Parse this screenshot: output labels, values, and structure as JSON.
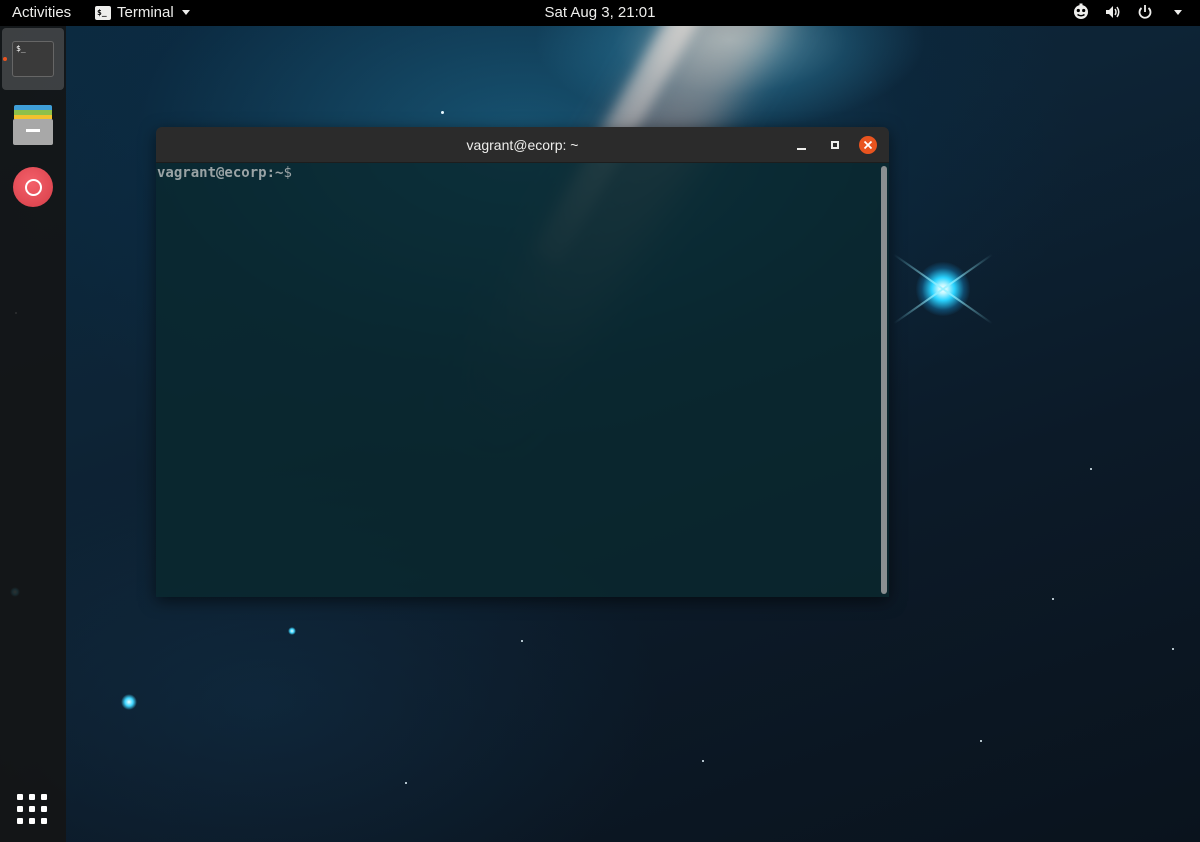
{
  "topbar": {
    "activities_label": "Activities",
    "app_menu_label": "Terminal",
    "app_menu_icon_text": "$_",
    "clock": "Sat Aug  3, 21:01",
    "tray_icons": [
      "accessibility-icon",
      "volume-icon",
      "power-icon",
      "system-menu-caret-icon"
    ]
  },
  "dock": {
    "items": [
      {
        "name": "Terminal",
        "icon": "terminal-icon",
        "icon_text": "$_",
        "active": true,
        "running": true
      },
      {
        "name": "Files",
        "icon": "files-icon",
        "active": false
      },
      {
        "name": "Help",
        "icon": "help-icon",
        "active": false
      }
    ],
    "show_apps_icon": "show-applications-grid-icon"
  },
  "terminal_window": {
    "title": "vagrant@ecorp: ~",
    "prompt_user_host": "vagrant@ecorp",
    "prompt_path": ":~",
    "prompt_symbol": "$",
    "buttons": [
      "minimize",
      "maximize",
      "close"
    ]
  },
  "colors": {
    "accent": "#e9541f",
    "topbar_bg": "#000000",
    "terminal_bg": "#0a282e",
    "prompt_text": "#9aa3a5"
  }
}
